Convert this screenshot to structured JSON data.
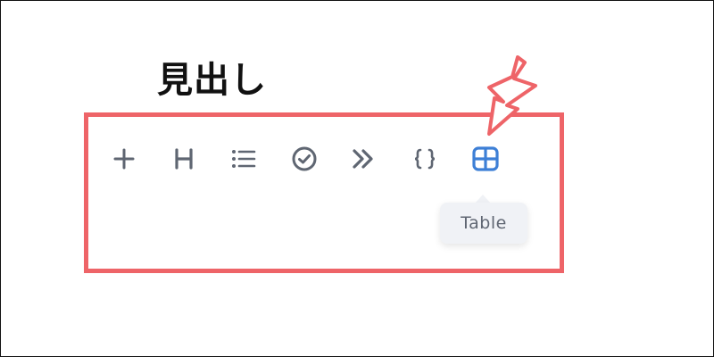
{
  "heading": "見出し",
  "toolbar": {
    "buttons": [
      {
        "name": "add-block-button",
        "icon": "plus-icon"
      },
      {
        "name": "heading-button",
        "icon": "heading-icon"
      },
      {
        "name": "bullet-list-button",
        "icon": "list-icon"
      },
      {
        "name": "todo-button",
        "icon": "check-circle-icon"
      },
      {
        "name": "toggle-button",
        "icon": "double-chevron-right-icon"
      },
      {
        "name": "code-block-button",
        "icon": "braces-icon"
      },
      {
        "name": "table-button",
        "icon": "table-icon",
        "active": true
      }
    ]
  },
  "tooltip": {
    "text": "Table"
  },
  "colors": {
    "highlight": "#ee6468",
    "icon": "#5f6672",
    "active_icon": "#3d7fd6",
    "tooltip_bg": "#f0f2f6"
  }
}
